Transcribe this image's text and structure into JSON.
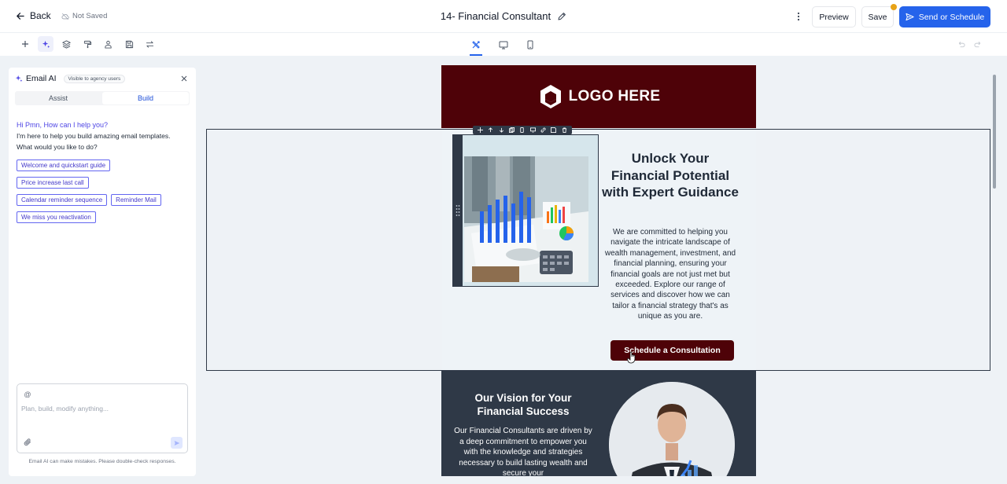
{
  "header": {
    "back_label": "Back",
    "save_status": "Not Saved",
    "title": "14- Financial Consultant",
    "preview_label": "Preview",
    "save_label": "Save",
    "send_label": "Send or Schedule"
  },
  "toolbar": {
    "tools": [
      "add-icon",
      "sparkle-icon",
      "layers-icon",
      "paint-roller-icon",
      "user-icon",
      "save-template-icon",
      "swap-icon"
    ],
    "views": [
      "design-tools-icon",
      "desktop-icon",
      "mobile-icon"
    ]
  },
  "ai_panel": {
    "title": "Email AI",
    "visibility_chip": "Visible to agency users",
    "tabs": [
      "Assist",
      "Build"
    ],
    "active_tab": "Build",
    "greeting": "Hi Pmn, How can I help you?",
    "intro": "I'm here to help you build amazing email templates. What would you like to do?",
    "suggestions": [
      "Welcome and quickstart guide",
      "Price increase last call",
      "Calendar reminder sequence",
      "Reminder Mail",
      "We miss you reactivation"
    ],
    "input_prefix": "@",
    "input_placeholder": "Plan, build, modify anything...",
    "disclaimer": "Email AI can make mistakes. Please double-check responses."
  },
  "email": {
    "logo_text": "LOGO HERE",
    "hero_title": "Unlock Your Financial Potential with Expert Guidance",
    "hero_body": "We are committed to helping you navigate the intricate landscape of wealth management, investment, and financial planning, ensuring your financial goals are not just met but exceeded. Explore our range of services and discover how we can tailor a financial strategy that's as unique as you are.",
    "cta_label": "Schedule a Consultation",
    "vision_title": "Our Vision for Your Financial Success",
    "vision_body": "Our Financial Consultants are driven by a deep commitment to empower you with the knowledge and strategies necessary to build lasting wealth and secure your"
  },
  "colors": {
    "brand_maroon": "#4e0208",
    "accent_blue": "#2563eb",
    "section_dark": "#2f3947",
    "notification": "#e8a317"
  }
}
